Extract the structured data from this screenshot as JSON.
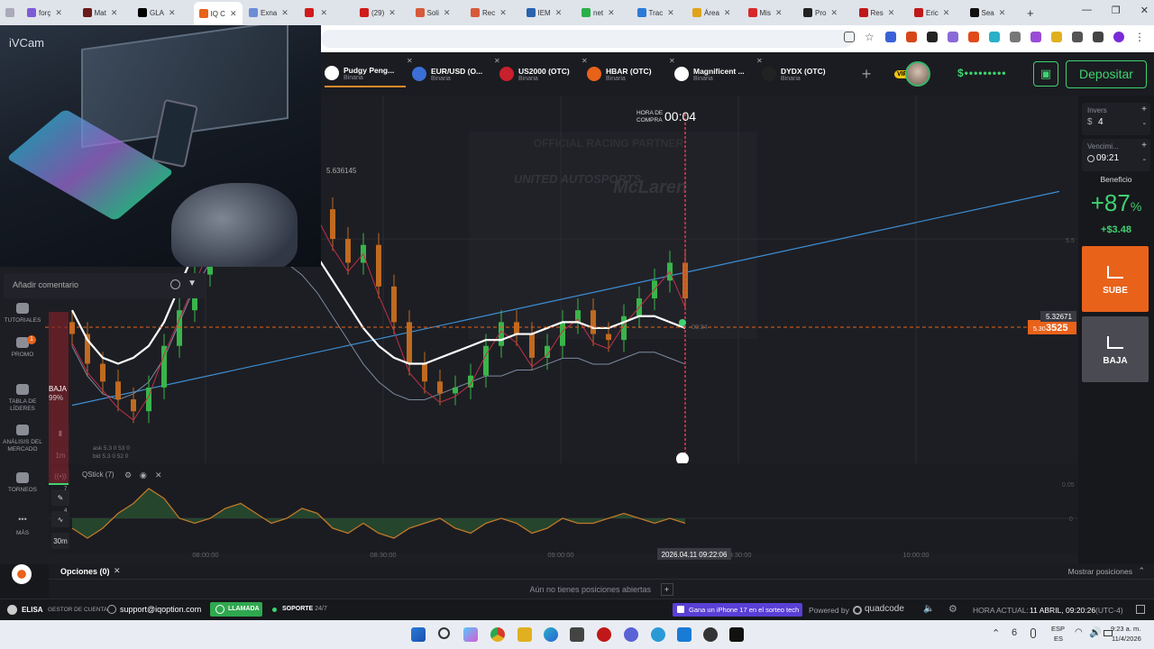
{
  "browser": {
    "tabs": [
      {
        "label": "forç",
        "color": "#7d5bd6"
      },
      {
        "label": "Mat",
        "color": "#6a1b1b"
      },
      {
        "label": "GLA",
        "color": "#000000"
      },
      {
        "label": "IQ C",
        "color": "#e8621a",
        "active": true
      },
      {
        "label": "Exna",
        "color": "#6c8ed6"
      },
      {
        "label": "",
        "color": "#d11a1a"
      },
      {
        "label": "(29)",
        "color": "#d11a1a"
      },
      {
        "label": "Soli",
        "color": "#d65a3a"
      },
      {
        "label": "Rec",
        "color": "#d65a3a"
      },
      {
        "label": "IEM",
        "color": "#2a62b0"
      },
      {
        "label": "net",
        "color": "#29b04a"
      },
      {
        "label": "Trac",
        "color": "#2a7bd6"
      },
      {
        "label": "Área",
        "color": "#e0a41a"
      },
      {
        "label": "Mis",
        "color": "#d62a2a"
      },
      {
        "label": "Pro",
        "color": "#222222"
      },
      {
        "label": "Res",
        "color": "#c01818"
      },
      {
        "label": "Eric",
        "color": "#c01818"
      },
      {
        "label": "Sea",
        "color": "#111111"
      }
    ],
    "new_tab": "+"
  },
  "webcam": {
    "label": "iVCam"
  },
  "assets": [
    {
      "name": "Pudgy Peng...",
      "type": "Binaria",
      "color": "#ffffff",
      "active": true
    },
    {
      "name": "EUR/USD (O...",
      "type": "Binaria",
      "color": "#3b6fd6"
    },
    {
      "name": "US2000 (OTC)",
      "type": "Binaria",
      "color": "#c8202c"
    },
    {
      "name": "HBAR (OTC)",
      "type": "Binaria",
      "color": "#e8621a"
    },
    {
      "name": "Magnificent ...",
      "type": "Binaria",
      "color": "#ffffff"
    },
    {
      "name": "DYDX (OTC)",
      "type": "Binaria",
      "color": "#222222"
    }
  ],
  "account": {
    "vip": "VIP",
    "balance": "$•••••••••",
    "deposit": "Depositar"
  },
  "chart": {
    "purchase_label": "HORA DE COMPRA",
    "timer": "00:04",
    "high_label": "5.636145",
    "current_price": "5.32671",
    "strike_price": "5.303525",
    "strike_small": "5.30",
    "strike_big": "3525",
    "level_right": "5.5",
    "bet_label": "00:34",
    "x_ticks": [
      "08:00:00",
      "08:30:00",
      "09:00:00",
      "09:30:00",
      "10:00:00"
    ],
    "cursor_time": "2026.04.11 09:22:06",
    "ask": "ask 5.3 0 53 0",
    "bid": "bid 5.3 0 52 0",
    "watermark": "OFFICIAL RACING PARTNER",
    "brand1": "UNITED AUTOSPORTS",
    "brand2": "McLaren",
    "indicator": {
      "name": "QStick (7)",
      "level_top": "0.05",
      "level_zero": "0"
    }
  },
  "chart_data": {
    "type": "line",
    "title": "",
    "x_ticks": [
      "08:00:00",
      "08:30:00",
      "09:00:00",
      "09:30:00",
      "10:00:00"
    ],
    "candles_close": [
      5.38,
      5.33,
      5.3,
      5.27,
      5.25,
      5.29,
      5.36,
      5.42,
      5.48,
      5.54,
      5.6,
      5.63,
      5.58,
      5.55,
      5.6,
      5.62,
      5.59,
      5.54,
      5.5,
      5.53,
      5.46,
      5.4,
      5.33,
      5.3,
      5.28,
      5.29,
      5.31,
      5.36,
      5.4,
      5.38,
      5.34,
      5.36,
      5.4,
      5.42,
      5.38,
      5.37,
      5.41,
      5.44,
      5.47,
      5.5,
      5.44
    ],
    "ma_white": [
      5.42,
      5.37,
      5.34,
      5.33,
      5.34,
      5.36,
      5.4,
      5.46,
      5.52,
      5.56,
      5.58,
      5.58,
      5.57,
      5.57,
      5.56,
      5.54,
      5.51,
      5.47,
      5.43,
      5.39,
      5.36,
      5.34,
      5.33,
      5.33,
      5.34,
      5.35,
      5.36,
      5.37,
      5.37,
      5.38,
      5.38,
      5.39,
      5.4,
      5.4,
      5.39,
      5.39,
      5.4,
      5.41,
      5.41,
      5.4,
      5.39
    ],
    "trendline": [
      [
        0,
        5.26
      ],
      [
        1,
        5.62
      ]
    ],
    "qstick": [
      -0.02,
      -0.04,
      -0.02,
      0.01,
      0.03,
      0.06,
      0.04,
      0.0,
      -0.01,
      0.0,
      0.02,
      0.03,
      0.01,
      -0.01,
      0.0,
      0.02,
      0.01,
      -0.02,
      -0.03,
      -0.01,
      -0.03,
      -0.04,
      -0.02,
      -0.01,
      0.0,
      -0.02,
      -0.03,
      -0.01,
      0.0,
      -0.01,
      -0.03,
      -0.02,
      0.0,
      -0.01,
      -0.01,
      0.0,
      0.01,
      0.0,
      -0.01,
      0.0,
      -0.01
    ]
  },
  "leftnav": {
    "comment_placeholder": "Añadir comentario",
    "items": [
      "TUTORIALES",
      "PROMO",
      "TABLA DE LÍDERES",
      "ANÁLISIS DEL MERCADO",
      "TORNEOS",
      "MÁS"
    ],
    "promo_badge": "1",
    "baja": "BAJA",
    "baja_pct": "99%",
    "tf1": "1m",
    "tf2": "30m",
    "badge7": "7",
    "badge4": "4"
  },
  "right": {
    "inv_label": "Invers",
    "inv_val": "4",
    "inv_cur": "$",
    "exp_label": "Vencimi...",
    "exp_val": "09:21",
    "profit_label": "Beneficio",
    "profit_pct": "+87",
    "pct_sign": "%",
    "profit_amt": "+$3.48",
    "up": "SUBE",
    "down": "BAJA"
  },
  "bottom": {
    "options": "Opciones",
    "options_count": "(0)",
    "no_positions": "Aún no tienes posiciones abiertas",
    "show_positions": "Mostrar posiciones",
    "user": "ELISA",
    "account_mgr": "GESTOR DE CUENTA",
    "email": "support@iqoption.com",
    "call": "LLAMADA",
    "support": "SOPORTE",
    "support_hours": "· 24/7",
    "promo": "Gana un iPhone 17 en el sorteo tech",
    "powered": "Powered by",
    "quadcode": "quadcode",
    "time_label": "HORA ACTUAL:",
    "time_val": "11 ABRIL, 09:20:26",
    "tz": "(UTC-4)"
  },
  "taskbar": {
    "lang": "ESP",
    "lang2": "ES",
    "clock": "9:23 a. m.",
    "date": "11/4/2026"
  }
}
